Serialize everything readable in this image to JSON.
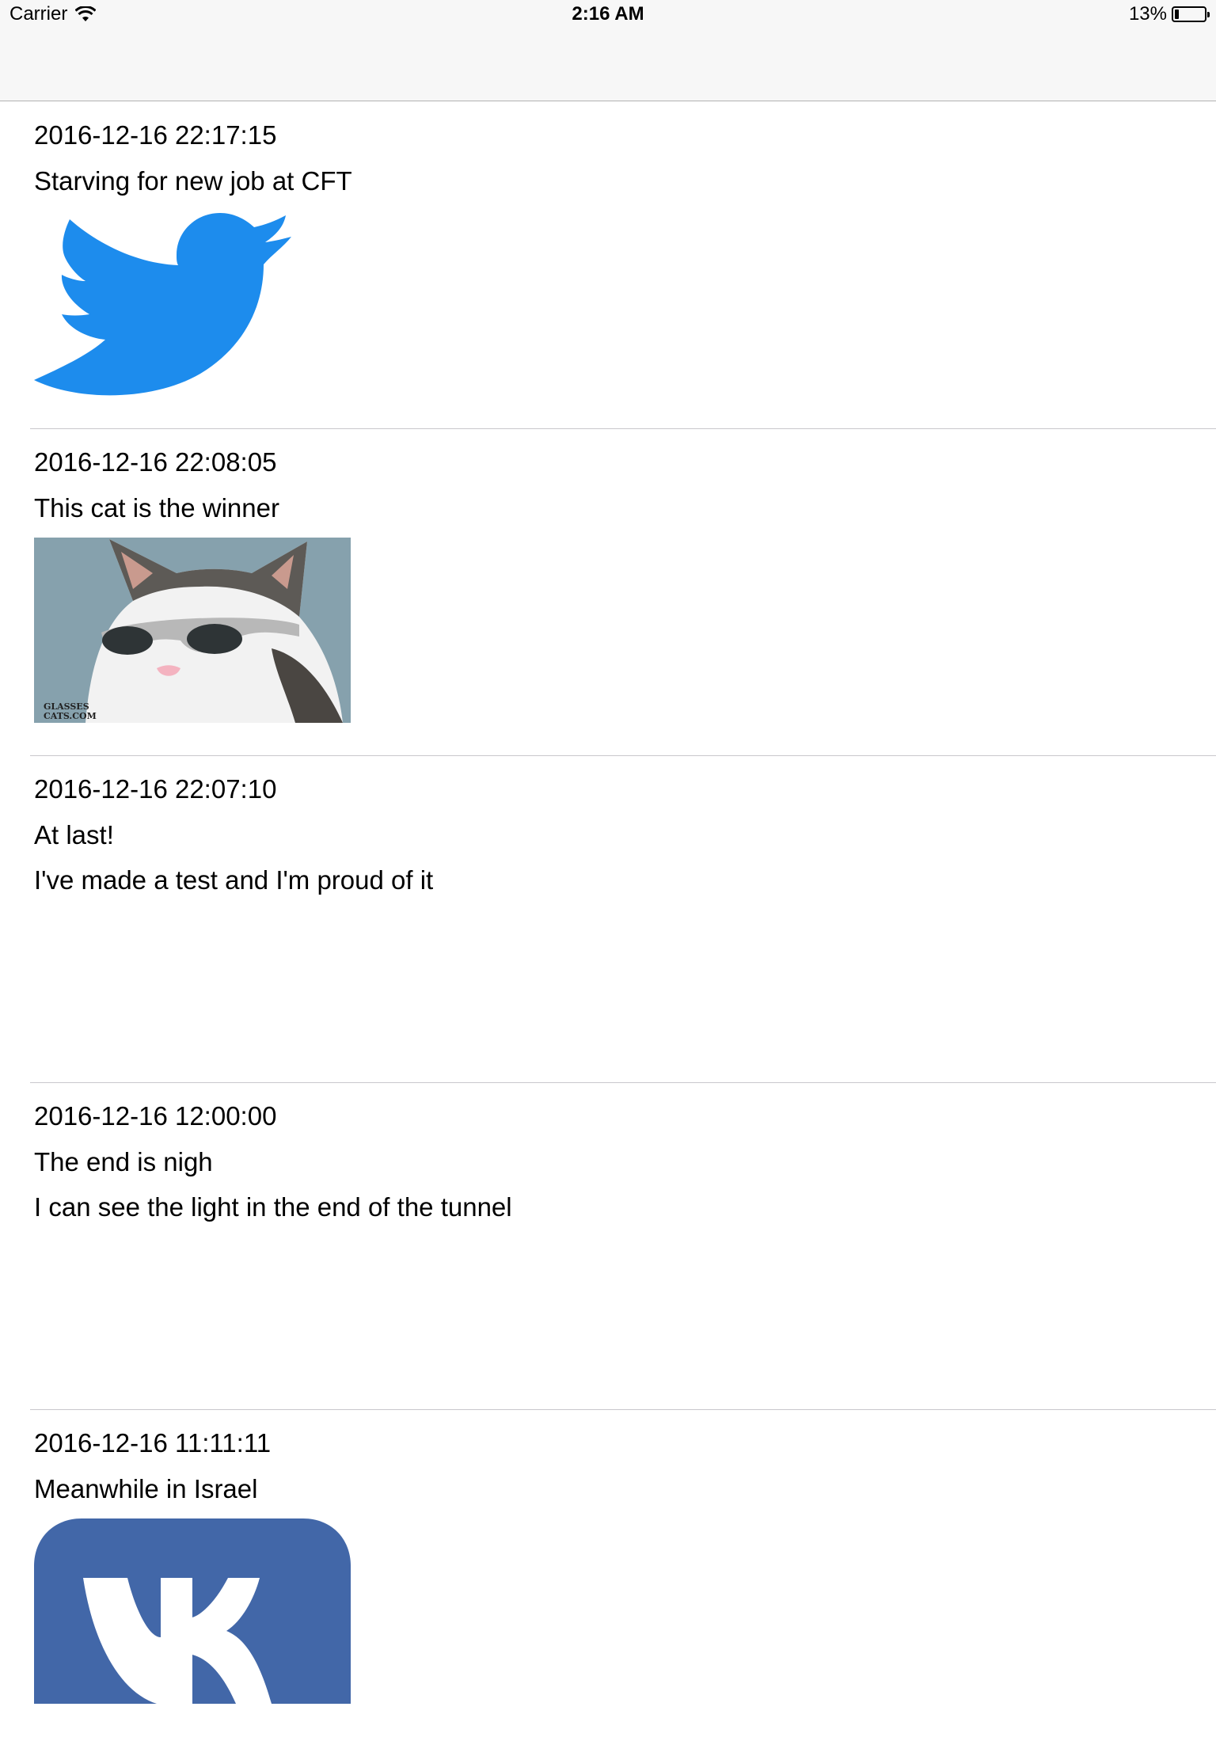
{
  "status_bar": {
    "carrier": "Carrier",
    "time": "2:16 AM",
    "battery_text": "13%",
    "battery_level": 0.13,
    "wifi_icon": "wifi-icon",
    "battery_icon": "battery-icon"
  },
  "posts": [
    {
      "date": "2016-12-16 22:17:15",
      "title": "Starving for new job at CFT",
      "image": "twitter-bird-image",
      "image_color": "#1d8ced"
    },
    {
      "date": "2016-12-16 22:08:05",
      "title": "This cat is the winner",
      "image": "cat-sunglasses-photo",
      "image_watermark": "GLASSES CATS.COM"
    },
    {
      "date": "2016-12-16 22:07:10",
      "title": "At last!",
      "body": "I've made a test and I'm proud of it"
    },
    {
      "date": "2016-12-16 12:00:00",
      "title": "The end is nigh",
      "body": "I can see the light in the end of the tunnel"
    },
    {
      "date": "2016-12-16 11:11:11",
      "title": "Meanwhile in Israel",
      "image": "vk-logo-image",
      "image_color": "#4267a8"
    }
  ]
}
